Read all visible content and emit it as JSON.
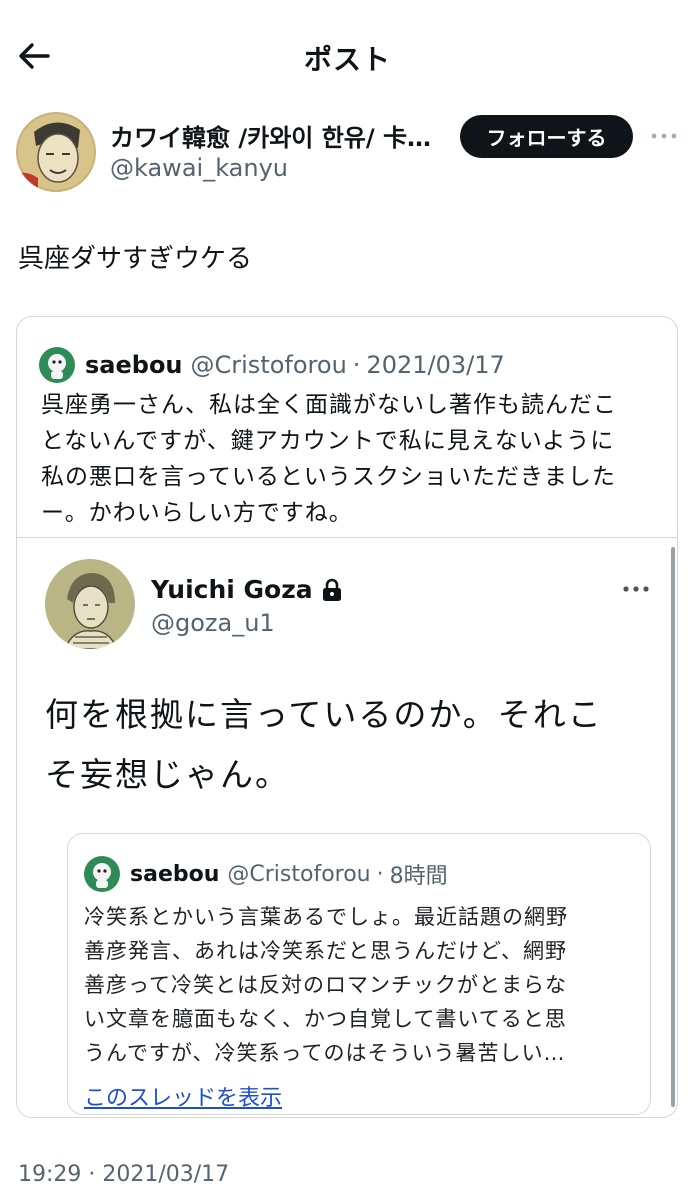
{
  "header": {
    "title": "ポスト",
    "back_icon": "arrow-left-icon"
  },
  "author": {
    "name": "カワイ韓愈 /카와이 한유/ 卡…",
    "handle": "@kawai_kanyu",
    "follow_label": "フォローする",
    "more_icon": "more-horizontal-icon"
  },
  "post": {
    "text": "呉座ダサすぎウケる"
  },
  "quoted": {
    "name": "saebou",
    "handle": "@Cristoforou",
    "sep": "·",
    "date": "2021/03/17",
    "lines": [
      "呉座勇一さん、私は全く面識がないし著作も読んだこ",
      "とないんですが、鍵アカウントで私に見えないように",
      "私の悪口を言っているというスクショいただきました",
      "ー。かわいらしい方ですね。"
    ],
    "screenshot": {
      "name": "Yuichi Goza",
      "lock_icon": "lock-icon",
      "handle": "@goza_u1",
      "lines": [
        "何を根拠に言っているのか。それこ",
        "そ妄想じゃん。"
      ],
      "inner": {
        "name": "saebou",
        "handle": "@Cristoforou",
        "sep": "·",
        "time": "8時間",
        "lines": [
          "冷笑系とかいう言葉あるでしょ。最近話題の網野",
          "善彦発言、あれは冷笑系だと思うんだけど、網野",
          "善彦って冷笑とは反対のロマンチックがとまらな",
          "い文章を臆面もなく、かつ自覚して書いてると思",
          "うんですが、冷笑系ってのはそういう暑苦しい…"
        ],
        "link": "このスレッドを表示"
      }
    }
  },
  "timestamp": "19:29 · 2021/03/17",
  "colors": {
    "accent_link": "#1d4ed8",
    "secondary_text": "#536471",
    "border": "#cfd9de",
    "button_bg": "#0f1419"
  }
}
